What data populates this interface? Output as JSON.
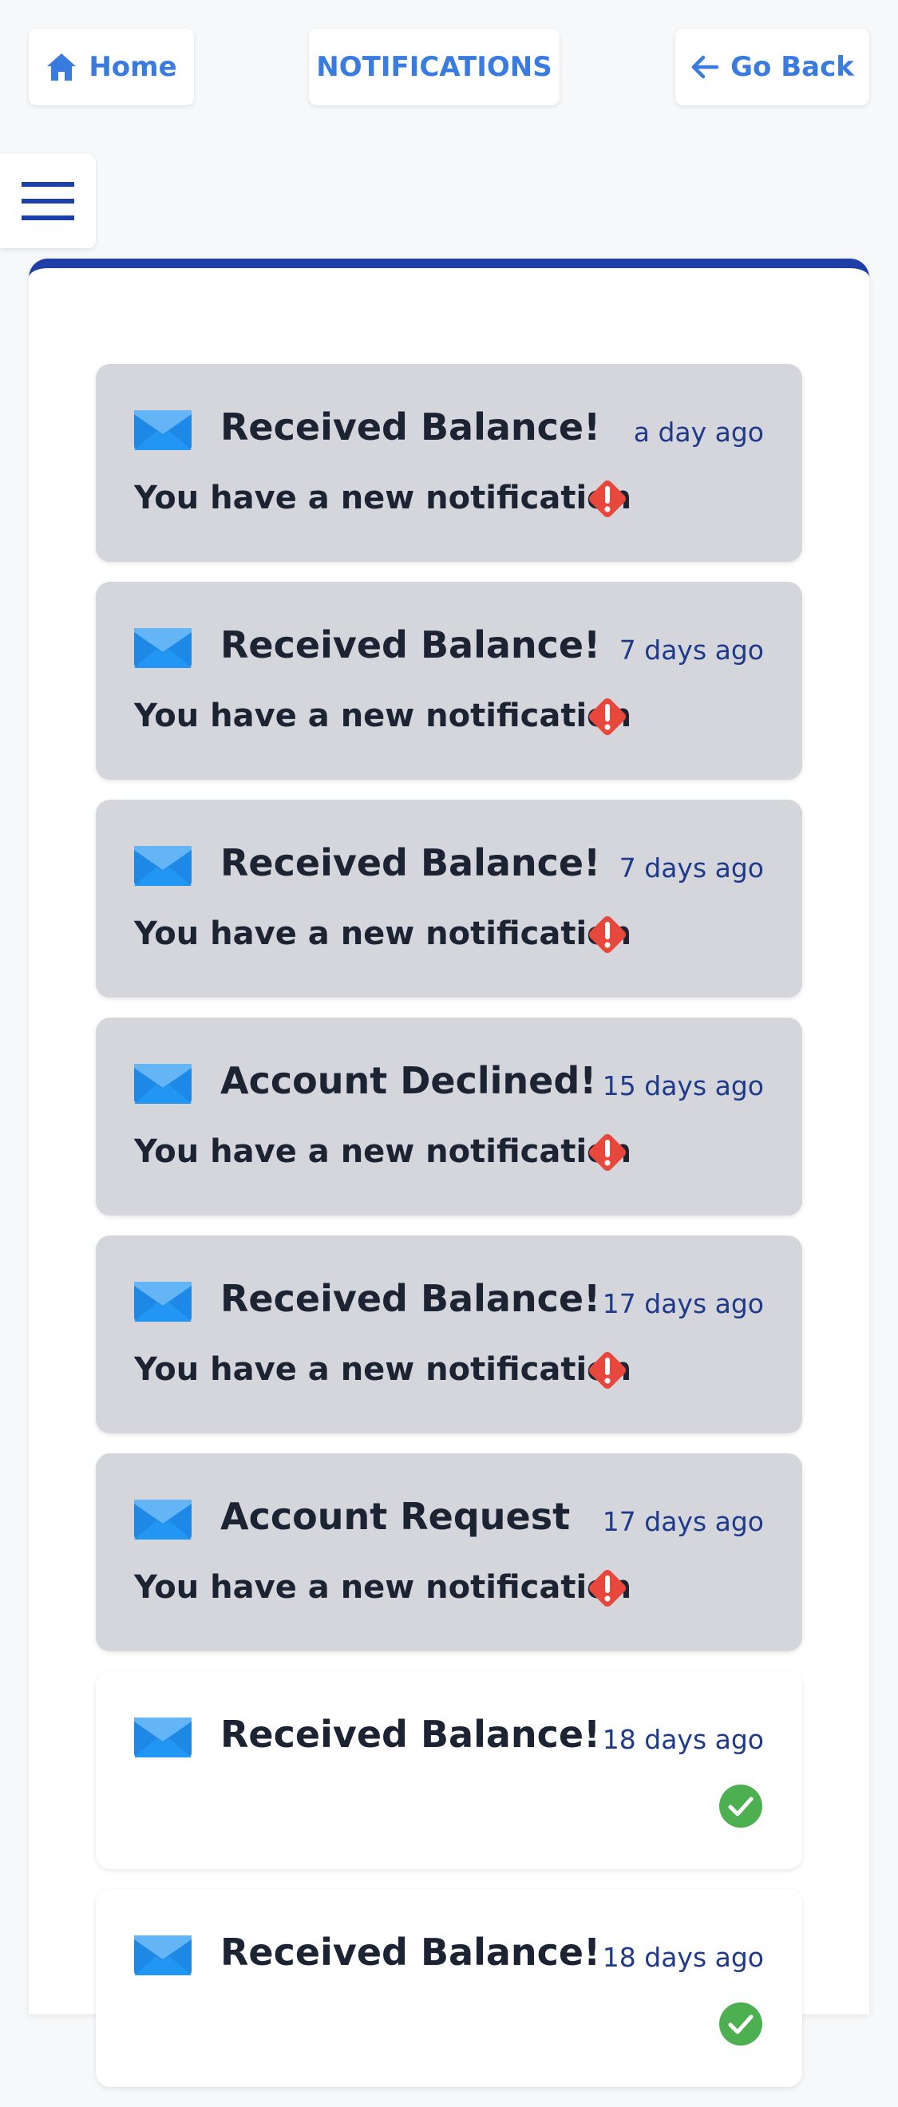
{
  "nav": {
    "home_label": "Home",
    "title": "NOTIFICATIONS",
    "back_label": "Go Back"
  },
  "icons": {
    "home": "home-icon",
    "back": "arrow-left-icon",
    "menu": "hamburger-menu-icon",
    "envelope": "envelope-icon",
    "alert": "alert-diamond-icon",
    "check": "check-circle-icon"
  },
  "colors": {
    "accent": "#3a7be0",
    "panel_border": "#1f3fa8",
    "unread_bg": "#d4d6dc",
    "read_bg": "#ffffff",
    "alert": "#e8473b",
    "success": "#4caf50"
  },
  "notifications": [
    {
      "title": "Received Balance!",
      "time": "a day ago",
      "message": "You have a new notification",
      "status": "unread"
    },
    {
      "title": "Received Balance!",
      "time": "7 days ago",
      "message": "You have a new notification",
      "status": "unread"
    },
    {
      "title": "Received Balance!",
      "time": "7 days ago",
      "message": "You have a new notification",
      "status": "unread"
    },
    {
      "title": "Account Declined!",
      "time": "15 days ago",
      "message": "You have a new notification",
      "status": "unread"
    },
    {
      "title": "Received Balance!",
      "time": "17 days ago",
      "message": "You have a new notification",
      "status": "unread"
    },
    {
      "title": "Account Request",
      "time": "17 days ago",
      "message": "You have a new notification",
      "status": "unread"
    },
    {
      "title": "Received Balance!",
      "time": "18 days ago",
      "message": "",
      "status": "read"
    },
    {
      "title": "Received Balance!",
      "time": "18 days ago",
      "message": "",
      "status": "read"
    }
  ]
}
